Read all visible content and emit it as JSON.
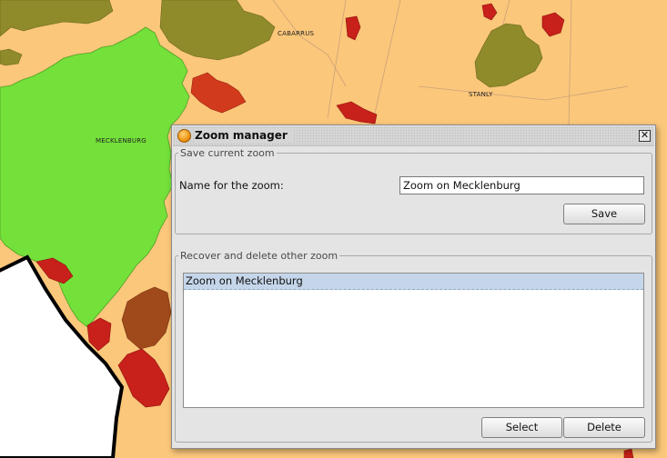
{
  "map": {
    "labels": {
      "cabarrus": "CABARRUS",
      "stanly": "STANLY",
      "mecklenburg": "MECKLENBURG"
    }
  },
  "dialog": {
    "title": "Zoom manager",
    "close_symbol": "✕",
    "save_section": {
      "title": "Save current zoom",
      "name_label": "Name for the zoom:",
      "name_value": "Zoom on Mecklenburg",
      "save_label": "Save"
    },
    "recover_section": {
      "title": "Recover and delete other zoom",
      "items": [
        "Zoom on Mecklenburg"
      ],
      "select_label": "Select",
      "delete_label": "Delete"
    }
  }
}
